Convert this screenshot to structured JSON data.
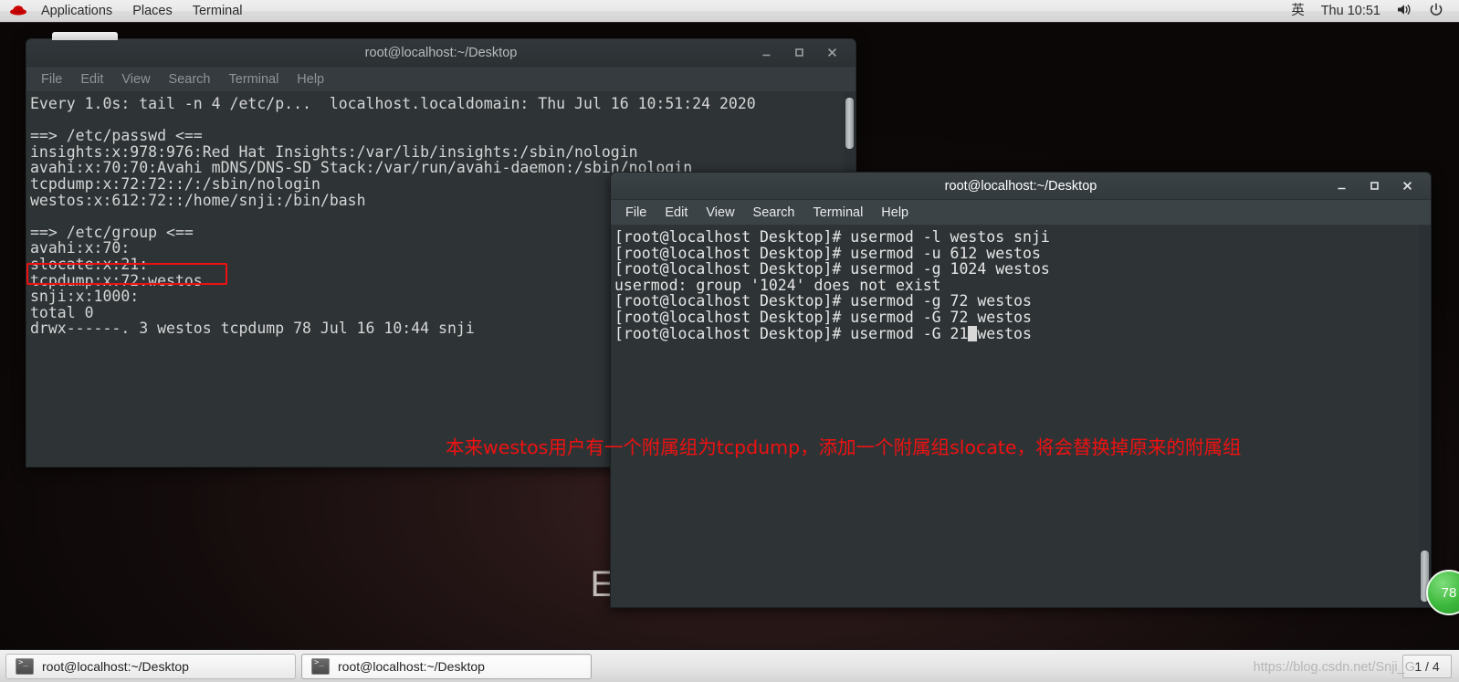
{
  "top_panel": {
    "logo_icon": "redhat-logo-icon",
    "menus": [
      "Applications",
      "Places",
      "Terminal"
    ],
    "input_method": "英",
    "clock": "Thu 10:51",
    "volume_icon": "volume-icon",
    "power_icon": "power-icon"
  },
  "desktop": {
    "wallpaper_text": "Enterprise Linux"
  },
  "window1": {
    "title": "root@localhost:~/Desktop",
    "menus": [
      "File",
      "Edit",
      "View",
      "Search",
      "Terminal",
      "Help"
    ],
    "minimize_icon": "minimize-icon",
    "maximize_icon": "maximize-icon",
    "close_icon": "close-icon",
    "content": "Every 1.0s: tail -n 4 /etc/p...  localhost.localdomain: Thu Jul 16 10:51:24 2020\n\n==> /etc/passwd <==\ninsights:x:978:976:Red Hat Insights:/var/lib/insights:/sbin/nologin\navahi:x:70:70:Avahi mDNS/DNS-SD Stack:/var/run/avahi-daemon:/sbin/nologin\ntcpdump:x:72:72::/:/sbin/nologin\nwestos:x:612:72::/home/snji:/bin/bash\n\n==> /etc/group <==\navahi:x:70:\nslocate:x:21:\ntcpdump:x:72:westos\nsnji:x:1000:\ntotal 0\ndrwx------. 3 westos tcpdump 78 Jul 16 10:44 snji"
  },
  "window2": {
    "title": "root@localhost:~/Desktop",
    "menus": [
      "File",
      "Edit",
      "View",
      "Search",
      "Terminal",
      "Help"
    ],
    "minimize_icon": "minimize-icon",
    "maximize_icon": "maximize-icon",
    "close_icon": "close-icon",
    "lines": [
      "[root@localhost Desktop]# usermod -l westos snji",
      "[root@localhost Desktop]# usermod -u 612 westos",
      "[root@localhost Desktop]# usermod -g 1024 westos",
      "usermod: group '1024' does not exist",
      "[root@localhost Desktop]# usermod -g 72 westos",
      "[root@localhost Desktop]# usermod -G 72 westos"
    ],
    "current_line_prefix": "[root@localhost Desktop]# usermod -G 21",
    "current_line_cursor": " ",
    "current_line_suffix": "westos"
  },
  "annotations": {
    "highlight_target": "tcpdump:x:72:westos",
    "note_text": "本来westos用户有一个附属组为tcpdump，添加一个附属组slocate，将会替换掉原来的附属组",
    "note_color": "#ee1111",
    "box_color": "#ee1111"
  },
  "badge": {
    "count": "78",
    "color": "#3cb83c"
  },
  "taskbar": {
    "tasks": [
      {
        "label": "root@localhost:~/Desktop",
        "icon": "terminal-icon",
        "active": false
      },
      {
        "label": "root@localhost:~/Desktop",
        "icon": "terminal-icon",
        "active": true
      }
    ],
    "workspace": "1 / 4",
    "watermark": "https://blog.csdn.net/Snji_G"
  }
}
